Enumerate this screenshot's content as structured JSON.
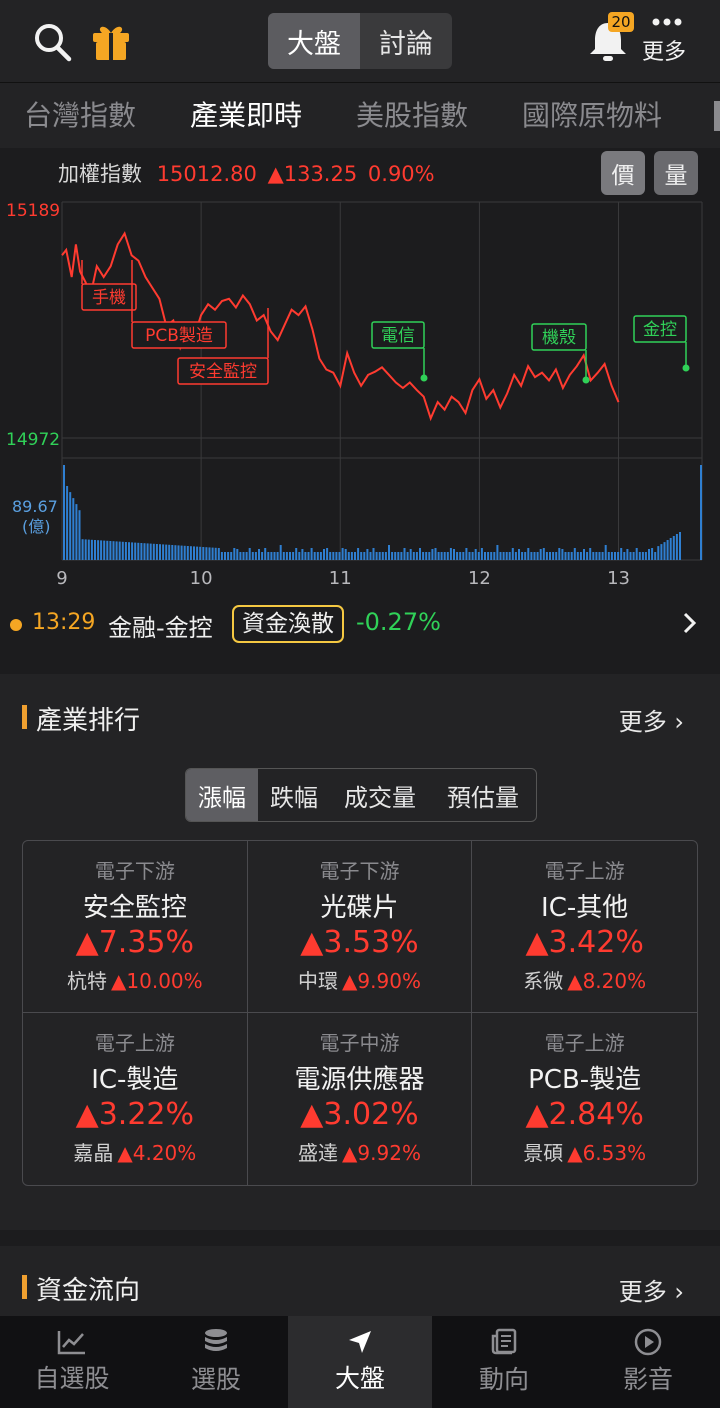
{
  "topbar": {
    "segments": [
      {
        "label": "大盤",
        "active": true
      },
      {
        "label": "討論",
        "active": false
      }
    ],
    "notification_count": "20",
    "more_label": "更多"
  },
  "tabs": [
    {
      "label": "台灣指數",
      "active": false
    },
    {
      "label": "產業即時",
      "active": true
    },
    {
      "label": "美股指數",
      "active": false
    },
    {
      "label": "國際原物料",
      "active": false
    }
  ],
  "index": {
    "name": "加權指數",
    "value": "15012.80",
    "change": "▲133.25",
    "change_pct": "0.90%",
    "toggle_price": "價",
    "toggle_volume": "量"
  },
  "chart_data": {
    "type": "line",
    "title": "加權指數",
    "ymax_label": "15189",
    "ymin_label": "14972",
    "ylim": [
      14972,
      15189
    ],
    "volume_label": "89.67",
    "volume_unit": "(億)",
    "xlabels": [
      "9",
      "10",
      "11",
      "12",
      "13"
    ],
    "x": [
      9.0,
      9.03,
      9.07,
      9.1,
      9.13,
      9.17,
      9.2,
      9.25,
      9.3,
      9.35,
      9.4,
      9.45,
      9.5,
      9.55,
      9.6,
      9.65,
      9.7,
      9.75,
      9.8,
      9.85,
      9.9,
      9.95,
      10.0,
      10.05,
      10.1,
      10.15,
      10.2,
      10.25,
      10.3,
      10.35,
      10.4,
      10.45,
      10.5,
      10.55,
      10.6,
      10.65,
      10.7,
      10.75,
      10.8,
      10.85,
      10.9,
      10.95,
      11.0,
      11.05,
      11.1,
      11.15,
      11.2,
      11.25,
      11.3,
      11.35,
      11.4,
      11.45,
      11.5,
      11.55,
      11.6,
      11.65,
      11.7,
      11.75,
      11.8,
      11.85,
      11.9,
      11.95,
      12.0,
      12.05,
      12.1,
      12.15,
      12.2,
      12.25,
      12.3,
      12.35,
      12.4,
      12.45,
      12.5,
      12.55,
      12.6,
      12.65,
      12.7,
      12.75,
      12.8,
      12.85,
      12.9,
      12.95,
      13.0,
      13.05,
      13.1,
      13.15,
      13.2,
      13.25,
      13.3,
      13.35,
      13.4,
      13.45,
      13.5,
      13.55,
      13.58
    ],
    "y": [
      15140,
      15145,
      15120,
      15150,
      15125,
      15115,
      15100,
      15130,
      15120,
      15130,
      15150,
      15160,
      15140,
      15135,
      15120,
      15110,
      15100,
      15075,
      15080,
      15055,
      15070,
      15065,
      15085,
      15095,
      15090,
      15098,
      15100,
      15092,
      15103,
      15095,
      15080,
      15085,
      15070,
      15062,
      15076,
      15090,
      15085,
      15093,
      15072,
      15045,
      15035,
      15032,
      15020,
      15050,
      15032,
      15020,
      15030,
      15033,
      15037,
      15030,
      15023,
      15018,
      15023,
      15016,
      15010,
      14990,
      15005,
      14998,
      15010,
      15005,
      14995,
      15016,
      15026,
      15008,
      15016,
      15000,
      15013,
      15030,
      15020,
      15038,
      15028,
      15032,
      15025,
      15035,
      15018,
      15030,
      15038,
      15048,
      15025,
      15032,
      15040,
      15020,
      15005
    ],
    "annotations": [
      {
        "label": "手機",
        "color": "red"
      },
      {
        "label": "PCB製造",
        "color": "red"
      },
      {
        "label": "安全監控",
        "color": "red"
      },
      {
        "label": "電信",
        "color": "green"
      },
      {
        "label": "機殼",
        "color": "green"
      },
      {
        "label": "金控",
        "color": "green"
      }
    ]
  },
  "status": {
    "time": "13:29",
    "sector": "金融-金控",
    "tag": "資金渙散",
    "pct": "-0.27%"
  },
  "ranking": {
    "title": "產業排行",
    "more": "更多",
    "segments": [
      {
        "label": "漲幅",
        "active": true
      },
      {
        "label": "跌幅",
        "active": false
      },
      {
        "label": "成交量",
        "active": false
      },
      {
        "label": "預估量",
        "active": false
      }
    ],
    "cells": [
      {
        "category": "電子下游",
        "name": "安全監控",
        "pct": "▲7.35%",
        "top_name": "杭特",
        "top_pct": "▲10.00%"
      },
      {
        "category": "電子下游",
        "name": "光碟片",
        "pct": "▲3.53%",
        "top_name": "中環",
        "top_pct": "▲9.90%"
      },
      {
        "category": "電子上游",
        "name": "IC-其他",
        "pct": "▲3.42%",
        "top_name": "系微",
        "top_pct": "▲8.20%"
      },
      {
        "category": "電子上游",
        "name": "IC-製造",
        "pct": "▲3.22%",
        "top_name": "嘉晶",
        "top_pct": "▲4.20%"
      },
      {
        "category": "電子中游",
        "name": "電源供應器",
        "pct": "▲3.02%",
        "top_name": "盛達",
        "top_pct": "▲9.92%"
      },
      {
        "category": "電子上游",
        "name": "PCB-製造",
        "pct": "▲2.84%",
        "top_name": "景碩",
        "top_pct": "▲6.53%"
      }
    ]
  },
  "flow": {
    "title": "資金流向",
    "more": "更多"
  },
  "bottom_nav": [
    {
      "label": "自選股",
      "icon": "chart-icon",
      "active": false
    },
    {
      "label": "選股",
      "icon": "stack-icon",
      "active": false
    },
    {
      "label": "大盤",
      "icon": "navigate-icon",
      "active": true
    },
    {
      "label": "動向",
      "icon": "news-icon",
      "active": false
    },
    {
      "label": "影音",
      "icon": "play-icon",
      "active": false
    }
  ],
  "colors": {
    "up": "#ff3b30",
    "down": "#30d158",
    "accent": "#f0a030",
    "volume": "#2f7fd1"
  }
}
